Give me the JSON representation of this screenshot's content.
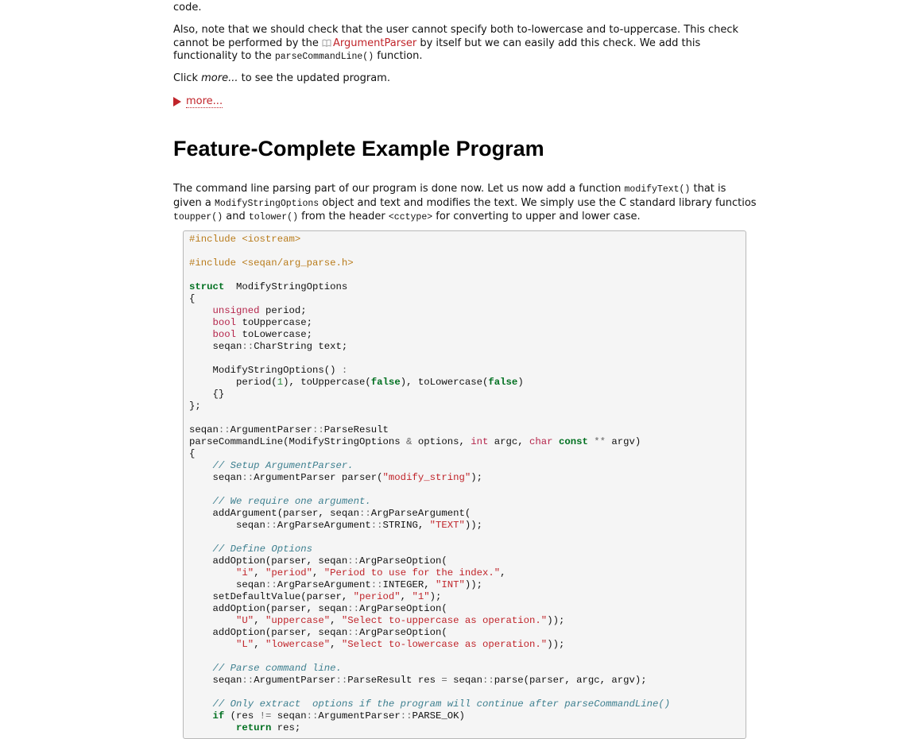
{
  "intro_tail": "code.",
  "para_check": {
    "before": "Also, note that we should check that the user cannot specify both to-lowercase and to-uppercase. This check cannot be performed by the ",
    "link": "ArgumentParser",
    "middle": " by itself but we can easily add this check. We add this functionality to the ",
    "code": "parseCommandLine()",
    "after": " function."
  },
  "para_click": {
    "before": "Click ",
    "em": "more...",
    "after": " to see the updated program."
  },
  "more_toggle": {
    "label": "more...",
    "icon": "triangle-right-icon",
    "color": "#c0242a"
  },
  "section": {
    "title": "Feature-Complete Example Program",
    "para": {
      "t1": "The command line parsing part of our program is done now. Let us now add a function ",
      "c1": "modifyText()",
      "t2": " that is given a ",
      "c2": "ModifyStringOptions",
      "t3": " object and text and modifies the text. We simply use the C standard library functios ",
      "c3": "toupper()",
      "t4": " and ",
      "c4": "tolower()",
      "t5": " from the header ",
      "c5": "<cctype>",
      "t6": " for converting to upper and lower case."
    }
  },
  "code_lines": [
    [
      [
        "pp",
        "#include <iostream>"
      ]
    ],
    [],
    [
      [
        "pp",
        "#include <seqan/arg_parse.h>"
      ]
    ],
    [],
    [
      [
        "kw",
        "struct"
      ],
      [
        "",
        "  ModifyStringOptions"
      ]
    ],
    [
      [
        "",
        "{"
      ]
    ],
    [
      [
        "",
        "    "
      ],
      [
        "ty",
        "unsigned"
      ],
      [
        "",
        " period;"
      ]
    ],
    [
      [
        "",
        "    "
      ],
      [
        "ty",
        "bool"
      ],
      [
        "",
        " toUppercase;"
      ]
    ],
    [
      [
        "",
        "    "
      ],
      [
        "ty",
        "bool"
      ],
      [
        "",
        " toLowercase;"
      ]
    ],
    [
      [
        "",
        "    seqan"
      ],
      [
        "op",
        "::"
      ],
      [
        "",
        "CharString text;"
      ]
    ],
    [],
    [
      [
        "",
        "    ModifyStringOptions() "
      ],
      [
        "op",
        ":"
      ]
    ],
    [
      [
        "",
        "        period("
      ],
      [
        "nm",
        "1"
      ],
      [
        "",
        "), toUppercase("
      ],
      [
        "kw",
        "false"
      ],
      [
        "",
        "), toLowercase("
      ],
      [
        "kw",
        "false"
      ],
      [
        "",
        ")"
      ]
    ],
    [
      [
        "",
        "    {}"
      ]
    ],
    [
      [
        "",
        "};"
      ]
    ],
    [],
    [
      [
        "",
        "seqan"
      ],
      [
        "op",
        "::"
      ],
      [
        "",
        "ArgumentParser"
      ],
      [
        "op",
        "::"
      ],
      [
        "",
        "ParseResult"
      ]
    ],
    [
      [
        "",
        "parseCommandLine(ModifyStringOptions "
      ],
      [
        "op",
        "&"
      ],
      [
        "",
        " options, "
      ],
      [
        "ty",
        "int"
      ],
      [
        "",
        " argc, "
      ],
      [
        "ty",
        "char"
      ],
      [
        "",
        " "
      ],
      [
        "kw",
        "const"
      ],
      [
        "",
        " "
      ],
      [
        "op",
        "**"
      ],
      [
        "",
        " argv)"
      ]
    ],
    [
      [
        "",
        "{"
      ]
    ],
    [
      [
        "",
        "    "
      ],
      [
        "cm",
        "// Setup ArgumentParser."
      ]
    ],
    [
      [
        "",
        "    seqan"
      ],
      [
        "op",
        "::"
      ],
      [
        "",
        "ArgumentParser parser("
      ],
      [
        "st",
        "\"modify_string\""
      ],
      [
        "",
        ");"
      ]
    ],
    [],
    [
      [
        "",
        "    "
      ],
      [
        "cm",
        "// We require one argument."
      ]
    ],
    [
      [
        "",
        "    addArgument(parser, seqan"
      ],
      [
        "op",
        "::"
      ],
      [
        "",
        "ArgParseArgument("
      ]
    ],
    [
      [
        "",
        "        seqan"
      ],
      [
        "op",
        "::"
      ],
      [
        "",
        "ArgParseArgument"
      ],
      [
        "op",
        "::"
      ],
      [
        "",
        "STRING, "
      ],
      [
        "st",
        "\"TEXT\""
      ],
      [
        "",
        "));"
      ]
    ],
    [],
    [
      [
        "",
        "    "
      ],
      [
        "cm",
        "// Define Options"
      ]
    ],
    [
      [
        "",
        "    addOption(parser, seqan"
      ],
      [
        "op",
        "::"
      ],
      [
        "",
        "ArgParseOption("
      ]
    ],
    [
      [
        "",
        "        "
      ],
      [
        "st",
        "\"i\""
      ],
      [
        "",
        ", "
      ],
      [
        "st",
        "\"period\""
      ],
      [
        "",
        ", "
      ],
      [
        "st",
        "\"Period to use for the index.\""
      ],
      [
        "",
        ","
      ]
    ],
    [
      [
        "",
        "        seqan"
      ],
      [
        "op",
        "::"
      ],
      [
        "",
        "ArgParseArgument"
      ],
      [
        "op",
        "::"
      ],
      [
        "",
        "INTEGER, "
      ],
      [
        "st",
        "\"INT\""
      ],
      [
        "",
        "));"
      ]
    ],
    [
      [
        "",
        "    setDefaultValue(parser, "
      ],
      [
        "st",
        "\"period\""
      ],
      [
        "",
        ", "
      ],
      [
        "st",
        "\"1\""
      ],
      [
        "",
        ");"
      ]
    ],
    [
      [
        "",
        "    addOption(parser, seqan"
      ],
      [
        "op",
        "::"
      ],
      [
        "",
        "ArgParseOption("
      ]
    ],
    [
      [
        "",
        "        "
      ],
      [
        "st",
        "\"U\""
      ],
      [
        "",
        ", "
      ],
      [
        "st",
        "\"uppercase\""
      ],
      [
        "",
        ", "
      ],
      [
        "st",
        "\"Select to-uppercase as operation.\""
      ],
      [
        "",
        "));"
      ]
    ],
    [
      [
        "",
        "    addOption(parser, seqan"
      ],
      [
        "op",
        "::"
      ],
      [
        "",
        "ArgParseOption("
      ]
    ],
    [
      [
        "",
        "        "
      ],
      [
        "st",
        "\"L\""
      ],
      [
        "",
        ", "
      ],
      [
        "st",
        "\"lowercase\""
      ],
      [
        "",
        ", "
      ],
      [
        "st",
        "\"Select to-lowercase as operation.\""
      ],
      [
        "",
        "));"
      ]
    ],
    [],
    [
      [
        "",
        "    "
      ],
      [
        "cm",
        "// Parse command line."
      ]
    ],
    [
      [
        "",
        "    seqan"
      ],
      [
        "op",
        "::"
      ],
      [
        "",
        "ArgumentParser"
      ],
      [
        "op",
        "::"
      ],
      [
        "",
        "ParseResult res "
      ],
      [
        "op",
        "="
      ],
      [
        "",
        " seqan"
      ],
      [
        "op",
        "::"
      ],
      [
        "",
        "parse(parser, argc, argv);"
      ]
    ],
    [],
    [
      [
        "",
        "    "
      ],
      [
        "cm",
        "// Only extract  options if the program will continue after parseCommandLine()"
      ]
    ],
    [
      [
        "",
        "    "
      ],
      [
        "kw",
        "if"
      ],
      [
        "",
        " (res "
      ],
      [
        "op",
        "!="
      ],
      [
        "",
        " seqan"
      ],
      [
        "op",
        "::"
      ],
      [
        "",
        "ArgumentParser"
      ],
      [
        "op",
        "::"
      ],
      [
        "",
        "PARSE_OK)"
      ]
    ],
    [
      [
        "",
        "        "
      ],
      [
        "kw",
        "return"
      ],
      [
        "",
        " res;"
      ]
    ]
  ]
}
